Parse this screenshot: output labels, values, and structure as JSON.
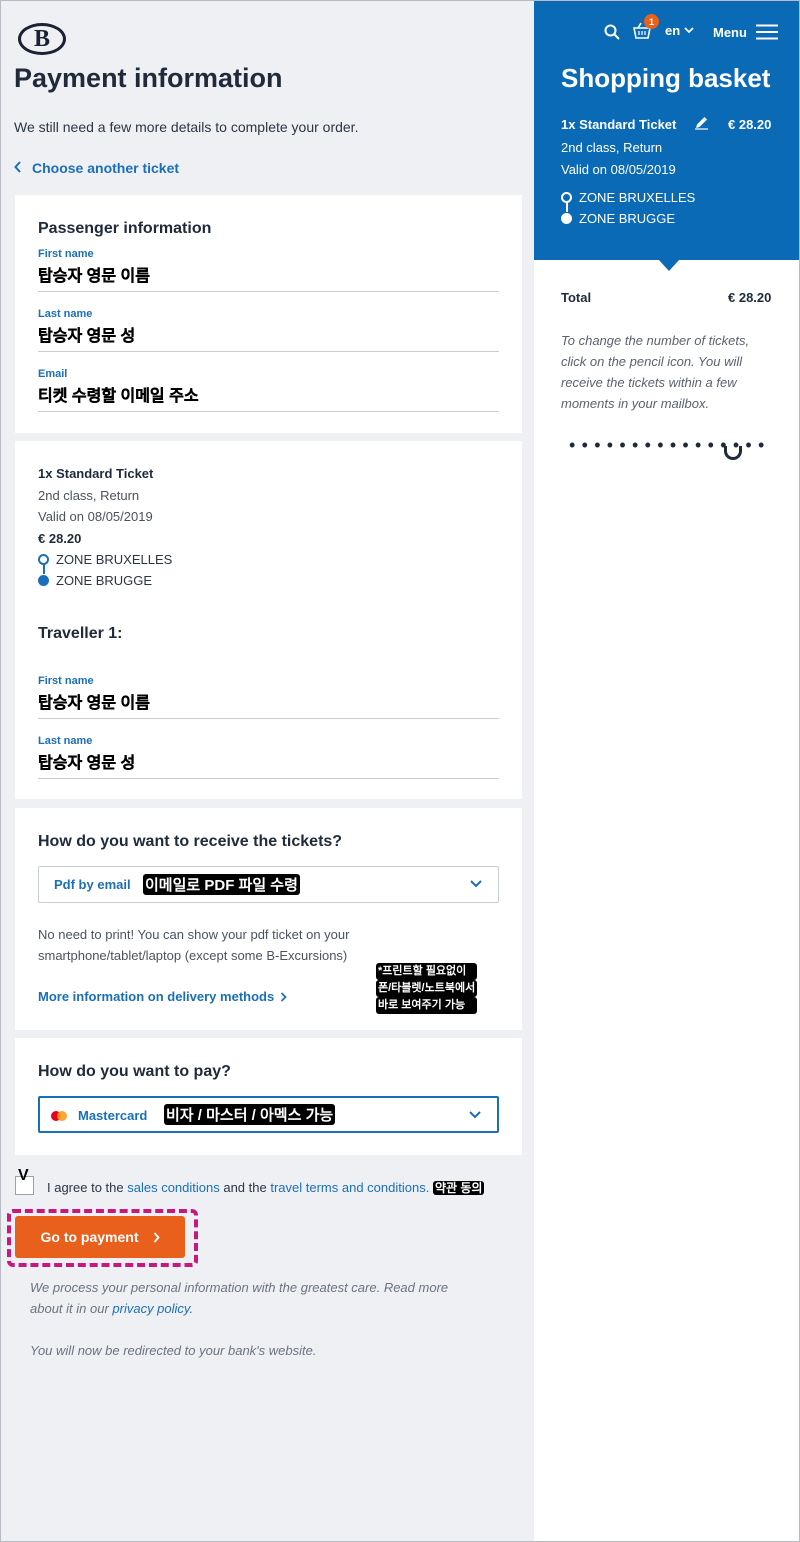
{
  "header": {
    "logo_text": "B",
    "title": "Payment information",
    "intro": "We still need a few more details to complete your order.",
    "back_link": "Choose another ticket"
  },
  "passenger": {
    "heading": "Passenger information",
    "fields": [
      {
        "label": "First name",
        "value": "탑승자 영문 이름"
      },
      {
        "label": "Last name",
        "value": "탑승자 영문 성"
      },
      {
        "label": "Email",
        "value": "티켓 수령할 이메일 주소"
      }
    ]
  },
  "ticket": {
    "name": "1x Standard Ticket",
    "class": "2nd class, Return",
    "valid": "Valid on 08/05/2019",
    "price": "€ 28.20",
    "zone_from": "ZONE BRUXELLES",
    "zone_to": "ZONE BRUGGE",
    "traveller_heading": "Traveller 1:",
    "traveller_fields": [
      {
        "label": "First name",
        "value": "탑승자 영문 이름"
      },
      {
        "label": "Last name",
        "value": "탑승자 영문 성"
      }
    ]
  },
  "delivery": {
    "heading": "How do you want to receive the tickets?",
    "selected": "Pdf by email",
    "annotation": "이메일로 PDF 파일 수령",
    "note_line1": "No need to print! You can show your pdf ticket on your",
    "note_line2": "smartphone/tablet/laptop (except some B-Excursions)",
    "more_link": "More information on delivery methods",
    "side_note_1": "*프린트할 필요없이",
    "side_note_2": "폰/타블렛/노트북에서",
    "side_note_3": "바로 보여주기 가능"
  },
  "payment": {
    "heading": "How do you want to pay?",
    "selected": "Mastercard",
    "annotation": "비자 / 마스터 / 아멕스 가능"
  },
  "agree": {
    "check_mark": "V",
    "prefix": "I agree to the ",
    "sales_link": "sales conditions",
    "middle": " and the ",
    "terms_link": "travel terms and conditions.",
    "annotation": "약관 동의"
  },
  "pay_button": {
    "label": "Go to payment"
  },
  "notes": {
    "privacy_1": "We process your personal information with the greatest care. Read more",
    "privacy_2": "about it in our ",
    "privacy_link": "privacy policy.",
    "redirect": "You will now be redirected to your bank's website."
  },
  "nav": {
    "basket_count": "1",
    "language": "en",
    "menu_label": "Menu"
  },
  "basket": {
    "title": "Shopping basket",
    "ticket_name": "1x Standard Ticket",
    "ticket_price": "€ 28.20",
    "class": "2nd class, Return",
    "valid": "Valid on 08/05/2019",
    "zone_from": "ZONE BRUXELLES",
    "zone_to": "ZONE BRUGGE",
    "total_label": "Total",
    "total_value": "€ 28.20",
    "note": "To change the number of tickets, click on the pencil icon. You will receive the tickets within a few moments in your mailbox.",
    "loading_dots": "••••••••••••••••"
  },
  "colors": {
    "brand_blue": "#0a6ab6",
    "link_blue": "#1b6fb8",
    "cta_orange": "#e8601c",
    "annotation_magenta": "#c8187e"
  }
}
